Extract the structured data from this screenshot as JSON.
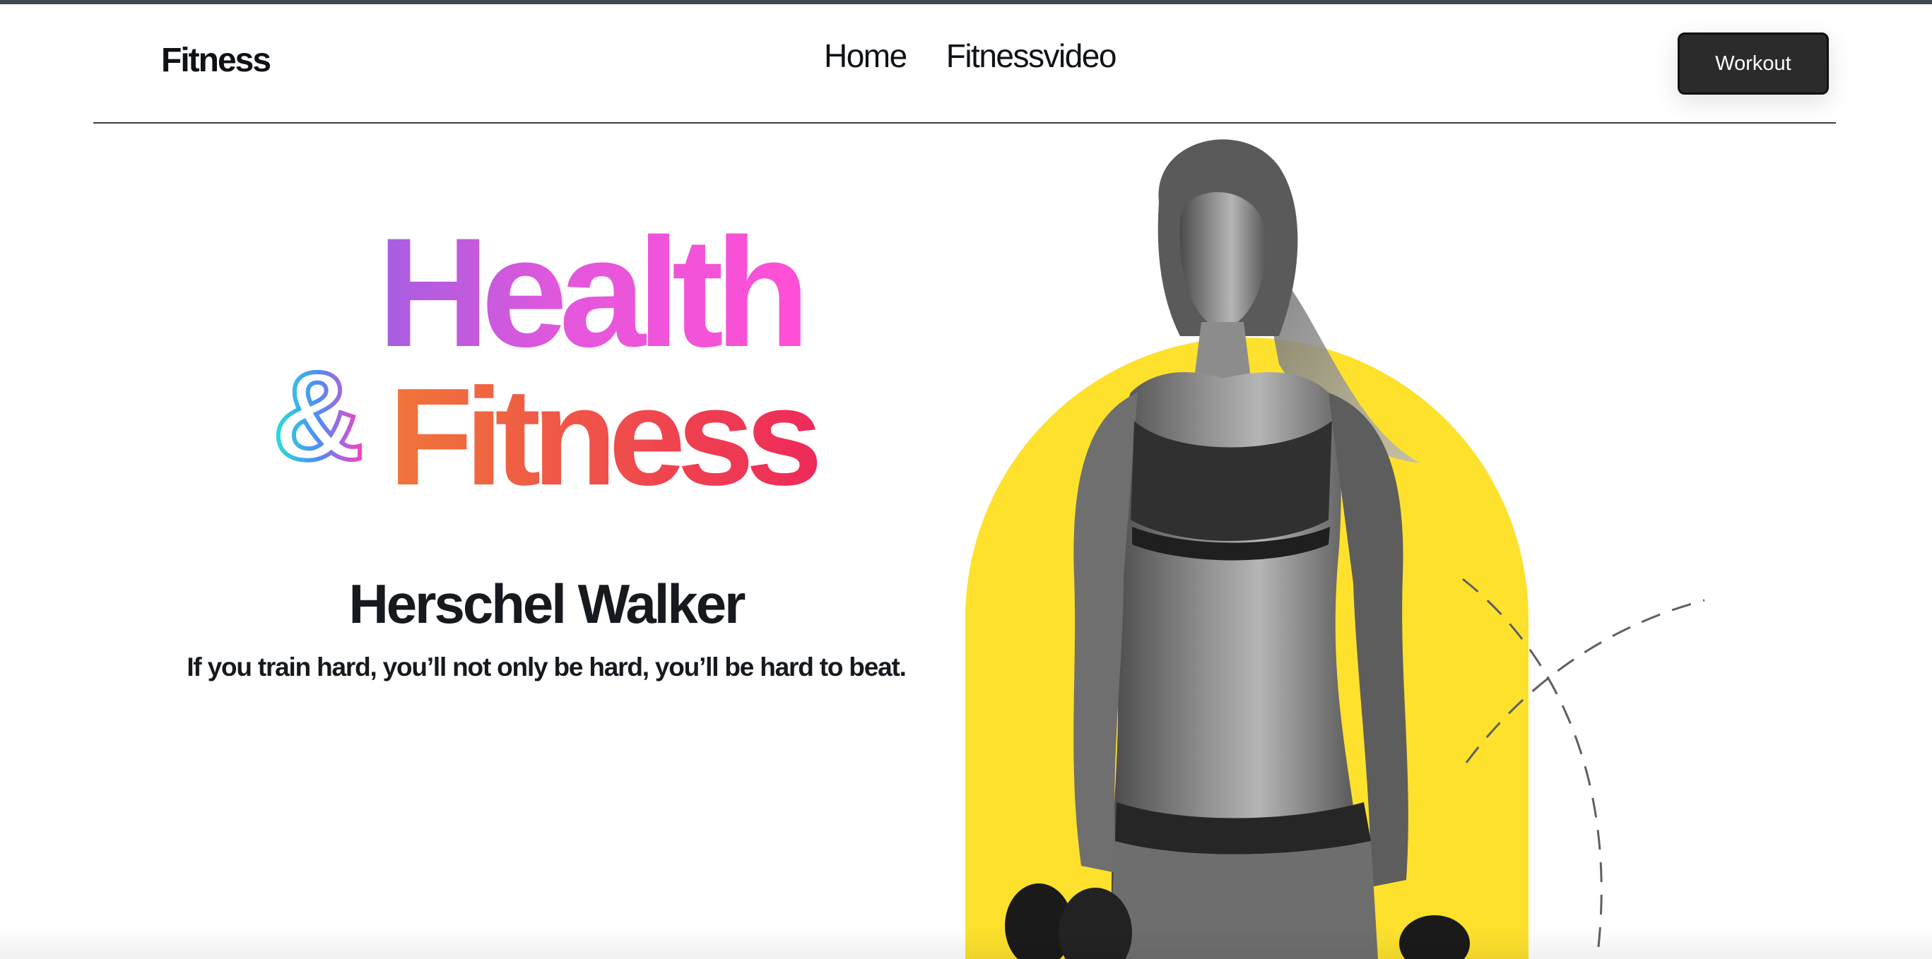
{
  "header": {
    "brand": "Fitness",
    "nav": [
      {
        "label": "Home"
      },
      {
        "label": "Fitnessvideo"
      }
    ],
    "cta_label": "Workout"
  },
  "hero": {
    "headline_top": "Health",
    "ampersand": "&",
    "headline_bottom": "Fitness",
    "quote_author": "Herschel Walker",
    "quote_text": "If you train hard, you’ll not only be hard, you’ll be hard to beat."
  },
  "image": {
    "subject": "athletic woman in sports bra holding dumbbells (black and white photo)",
    "backdrop": "yellow arch"
  },
  "colors": {
    "health_gradient_start": "#a45ee0",
    "health_gradient_end": "#ff4fd6",
    "fitness_gradient_start": "#f0763a",
    "fitness_gradient_end": "#ee2a5a",
    "ampersand_gradient": [
      "#27e3d5",
      "#4d8df6",
      "#ff3fbf"
    ],
    "arch": "#fde12d",
    "button_bg": "#2b2b2b",
    "text": "#111418"
  }
}
